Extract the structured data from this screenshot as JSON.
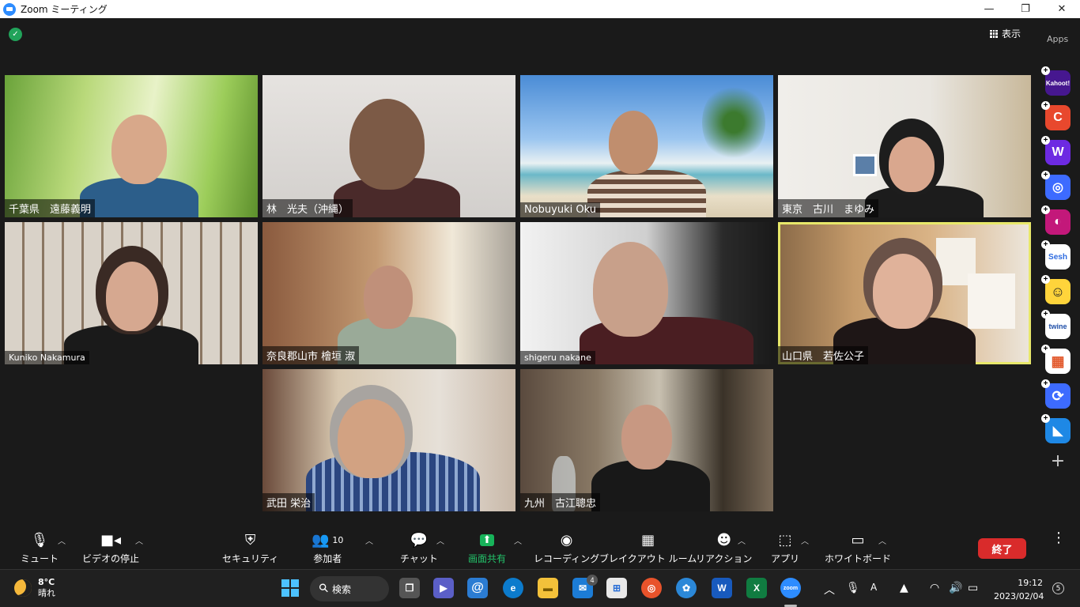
{
  "window": {
    "title": "Zoom ミーティング",
    "minimize": "—",
    "maximize": "❐",
    "close": "✕"
  },
  "top": {
    "view_label": "表示",
    "apps_label": "Apps"
  },
  "participants": [
    {
      "name": "千葉県　遠藤義明"
    },
    {
      "name": "林　光夫（沖縄）"
    },
    {
      "name": "Nobuyuki Oku"
    },
    {
      "name": "東京　古川　まゆみ"
    },
    {
      "name": "Kuniko Nakamura"
    },
    {
      "name": "奈良郡山市 檜垣 淑"
    },
    {
      "name": "shigeru nakane"
    },
    {
      "name": "山口県　若佐公子"
    },
    {
      "name": "武田 栄治"
    },
    {
      "name": "九州　古江聰忠"
    }
  ],
  "apps": [
    {
      "label": "Kahoot!",
      "color": "#46178f",
      "icon": "kahoot-icon"
    },
    {
      "label": "C",
      "color": "#e8482d",
      "icon": "c-app-icon"
    },
    {
      "label": "W",
      "color": "#6d2ae2",
      "icon": "wooclap-icon"
    },
    {
      "label": "◎",
      "color": "#3d6bff",
      "icon": "circle-app-icon"
    },
    {
      "label": "◐",
      "color": "#c3187a",
      "icon": "video-app-icon"
    },
    {
      "label": "Sesh",
      "color": "#ffffff",
      "icon": "sesh-icon"
    },
    {
      "label": "☺",
      "color": "#ffd43b",
      "icon": "smile-app-icon"
    },
    {
      "label": "twine",
      "color": "#ffffff",
      "icon": "twine-icon"
    },
    {
      "label": "▦",
      "color": "#ffffff",
      "icon": "grid-app-icon"
    },
    {
      "label": "⟳",
      "color": "#3d6bff",
      "icon": "sync-app-icon"
    },
    {
      "label": "◣",
      "color": "#1e88e5",
      "icon": "arrow-app-icon"
    }
  ],
  "toolbar": {
    "mute": "ミュート",
    "video": "ビデオの停止",
    "security": "セキュリティ",
    "participants": "参加者",
    "participants_count": "10",
    "chat": "チャット",
    "share": "画面共有",
    "record": "レコーディング",
    "breakout": "ブレイクアウト ルーム",
    "reactions": "リアクション",
    "apps": "アプリ",
    "whiteboard": "ホワイトボード",
    "end": "終了"
  },
  "taskbar": {
    "temperature": "8°C",
    "weather": "晴れ",
    "search": "検索",
    "mail_badge": "4",
    "time": "19:12",
    "date": "2023/02/04",
    "notifications": "5"
  },
  "colors": {
    "accent": "#2d8cff",
    "share_green": "#23c36a",
    "end_red": "#d92b2b",
    "active_speaker": "#e8e86a"
  }
}
